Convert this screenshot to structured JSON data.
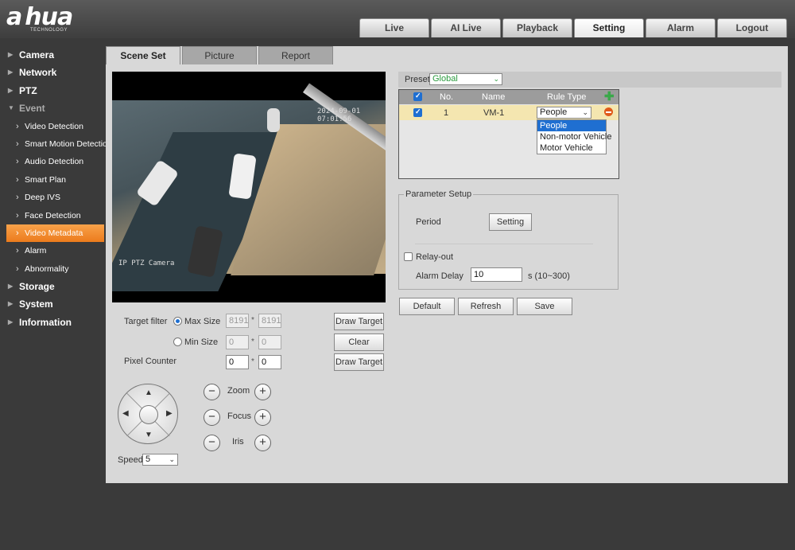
{
  "app": {
    "logo": "alhua",
    "logo_sub": "TECHNOLOGY"
  },
  "topnav": {
    "tabs": [
      {
        "label": "Live",
        "active": false
      },
      {
        "label": "AI Live",
        "active": false
      },
      {
        "label": "Playback",
        "active": false
      },
      {
        "label": "Setting",
        "active": true
      },
      {
        "label": "Alarm",
        "active": false
      },
      {
        "label": "Logout",
        "active": false
      }
    ]
  },
  "sidebar": {
    "camera": "Camera",
    "network": "Network",
    "ptz": "PTZ",
    "event": "Event",
    "sub": {
      "video_detection": "Video Detection",
      "smart_motion": "Smart Motion Detection",
      "audio_detection": "Audio Detection",
      "smart_plan": "Smart Plan",
      "deep_ivs": "Deep IVS",
      "face_detection": "Face Detection",
      "video_metadata": "Video Metadata",
      "alarm": "Alarm",
      "abnormality": "Abnormality"
    },
    "storage": "Storage",
    "system": "System",
    "information": "Information"
  },
  "subtabs": {
    "scene_set": "Scene Set",
    "picture": "Picture",
    "report": "Report"
  },
  "video": {
    "timestamp": "2024-09-01 07:01:56",
    "camera_name": "IP PTZ Camera"
  },
  "target": {
    "filter_label": "Target filter",
    "max_size_label": "Max Size",
    "max_w": "8191",
    "max_h": "8191",
    "min_size_label": "Min Size",
    "min_w": "0",
    "min_h": "0",
    "pixel_counter_label": "Pixel Counter",
    "pc_w": "0",
    "pc_h": "0",
    "sep": "*",
    "draw_target": "Draw Target",
    "clear": "Clear",
    "draw_target_2": "Draw Target"
  },
  "ptz": {
    "zoom": "Zoom",
    "focus": "Focus",
    "iris": "Iris",
    "speed_label": "Speed",
    "speed_value": "5",
    "minus": "−",
    "plus": "+",
    "up": "▲",
    "down": "▼",
    "left": "◀",
    "right": "▶"
  },
  "preset": {
    "label": "Preset",
    "value": "Global"
  },
  "rules": {
    "headers": {
      "no": "No.",
      "name": "Name",
      "rule_type": "Rule Type"
    },
    "rows": [
      {
        "no": "1",
        "name": "VM-1",
        "rule_type": "People"
      }
    ],
    "options": [
      "People",
      "Non-motor Vehicle",
      "Motor Vehicle"
    ]
  },
  "param": {
    "legend": "Parameter Setup",
    "period_label": "Period",
    "setting_button": "Setting",
    "relay_out_label": "Relay-out",
    "alarm_delay_label": "Alarm Delay",
    "alarm_delay_value": "10",
    "alarm_delay_unit": "s (10~300)"
  },
  "actions": {
    "default": "Default",
    "refresh": "Refresh",
    "save": "Save"
  },
  "colors": {
    "accent": "#ec7b1c",
    "selection": "#1f6fd1",
    "row_highlight": "#f4e6b0",
    "add": "#3aa84a",
    "remove": "#e05a1a"
  }
}
